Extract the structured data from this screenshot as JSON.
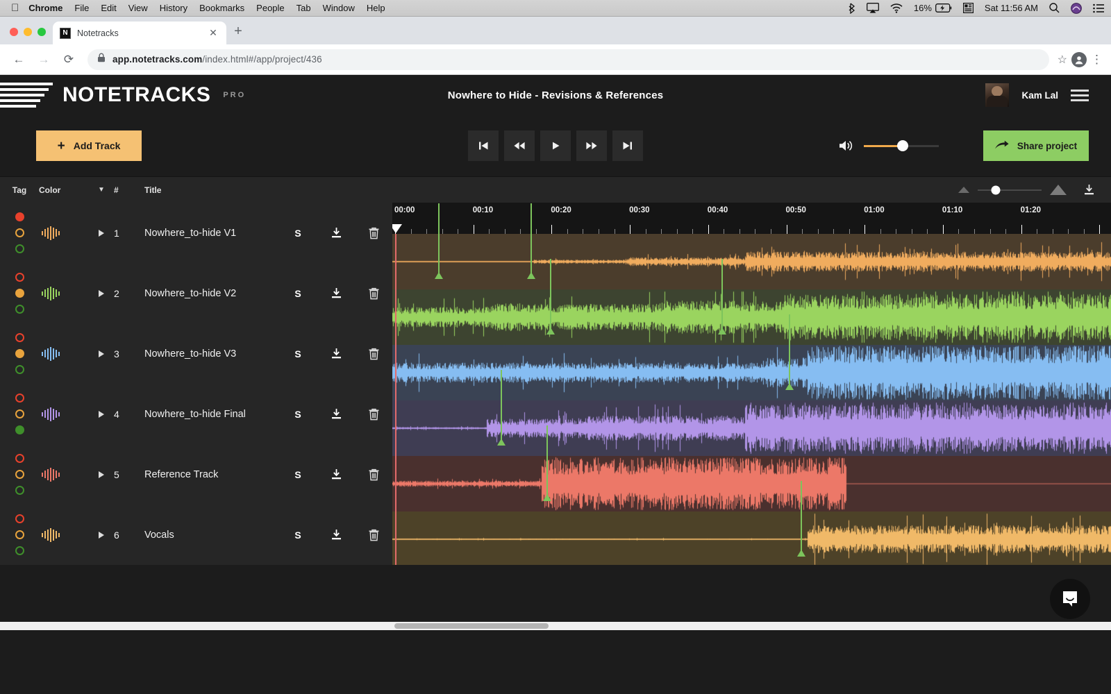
{
  "os_menubar": {
    "apple_icon": "apple-icon",
    "items": [
      "Chrome",
      "File",
      "Edit",
      "View",
      "History",
      "Bookmarks",
      "People",
      "Tab",
      "Window",
      "Help"
    ],
    "status": {
      "bluetooth_icon": "bluetooth-icon",
      "airplay_icon": "airplay-icon",
      "wifi_icon": "wifi-icon",
      "battery_percent": "16%",
      "battery_icon": "battery-charging-icon",
      "input_source_icon": "input-source-icon",
      "clock": "Sat 11:56 AM",
      "spotlight_icon": "search-icon",
      "siri_icon": "siri-icon",
      "control_center_icon": "control-center-icon"
    }
  },
  "browser": {
    "tab": {
      "title": "Notetracks",
      "favicon": "notetracks-favicon",
      "close_icon": "close-icon"
    },
    "new_tab_icon": "plus-icon",
    "back_icon": "back-arrow-icon",
    "forward_icon": "forward-arrow-icon",
    "reload_icon": "reload-icon",
    "lock_icon": "lock-icon",
    "url_bold": "app.notetracks.com",
    "url_dim": "/index.html#/app/project/436",
    "bookmark_icon": "star-icon",
    "profile_icon": "profile-avatar-icon",
    "menu_icon": "kebab-menu-icon"
  },
  "app": {
    "brand": "NOTETRACKS",
    "brand_tier": "PRO",
    "project_title": "Nowhere to Hide - Revisions & References",
    "user_name": "Kam Lal",
    "hamburger_icon": "hamburger-menu-icon",
    "toolbar": {
      "add_track_label": "Add Track",
      "add_track_icon": "plus-icon",
      "share_label": "Share project",
      "share_icon": "share-arrow-icon",
      "volume_icon": "speaker-icon",
      "volume_percent": 52,
      "transport": [
        {
          "name": "skip-to-start-button",
          "icon": "skip-start-icon"
        },
        {
          "name": "rewind-button",
          "icon": "rewind-icon"
        },
        {
          "name": "play-button",
          "icon": "play-icon"
        },
        {
          "name": "fast-forward-button",
          "icon": "fast-forward-icon"
        },
        {
          "name": "skip-to-end-button",
          "icon": "skip-end-icon"
        }
      ]
    },
    "table_header": {
      "tag": "Tag",
      "color": "Color",
      "caret_icon": "chevron-down-icon",
      "number": "#",
      "title": "Title",
      "zoom_out_icon": "zoom-small-icon",
      "zoom_in_icon": "zoom-large-icon",
      "zoom_value": 28,
      "download_icon": "download-icon"
    },
    "row_icons": {
      "solo": "S",
      "play_icon": "play-triangle-icon",
      "waveform_icon": "waveform-icon",
      "download_icon": "download-icon",
      "delete_icon": "trash-icon"
    },
    "tracks": [
      {
        "number": "1",
        "title": "Nowhere_to-hide V1",
        "wave_color": "#f0ac5e",
        "lane_bg": "#4b3d2c",
        "tags": {
          "red": true,
          "orange": false,
          "green": false
        }
      },
      {
        "number": "2",
        "title": "Nowhere_to-hide V2",
        "wave_color": "#9ad45f",
        "lane_bg": "#3d4430",
        "tags": {
          "red": false,
          "orange": true,
          "green": false
        }
      },
      {
        "number": "3",
        "title": "Nowhere_to-hide V3",
        "wave_color": "#86bdf2",
        "lane_bg": "#3a4354",
        "tags": {
          "red": false,
          "orange": true,
          "green": false
        }
      },
      {
        "number": "4",
        "title": "Nowhere_to-hide Final",
        "wave_color": "#b295e8",
        "lane_bg": "#3f3d53",
        "tags": {
          "red": false,
          "orange": false,
          "green": true
        }
      },
      {
        "number": "5",
        "title": "Reference Track",
        "wave_color": "#ec7868",
        "lane_bg": "#4a302e",
        "tags": {
          "red": false,
          "orange": false,
          "green": false
        }
      },
      {
        "number": "6",
        "title": "Vocals",
        "wave_color": "#f0b968",
        "lane_bg": "#4d4228",
        "tags": {
          "red": false,
          "orange": false,
          "green": false
        }
      }
    ],
    "timeline": {
      "tick_labels": [
        "00:00",
        "00:10",
        "00:20",
        "00:30",
        "00:40",
        "00:50",
        "01:00",
        "01:10",
        "01:20"
      ],
      "seconds_per_label": 10,
      "pixels_per_second": 11.27,
      "playhead_position_seconds": 0,
      "markers": [
        {
          "track": 1,
          "seconds": 5.5
        },
        {
          "track": 1,
          "seconds": 17.3
        },
        {
          "track": 2,
          "seconds": 19.8
        },
        {
          "track": 2,
          "seconds": 41.7
        },
        {
          "track": 3,
          "seconds": 50.3
        },
        {
          "track": 4,
          "seconds": 13.5
        },
        {
          "track": 5,
          "seconds": 19.3
        },
        {
          "track": 6,
          "seconds": 51.8
        }
      ]
    },
    "chat_widget_icon": "chat-bubble-icon"
  }
}
